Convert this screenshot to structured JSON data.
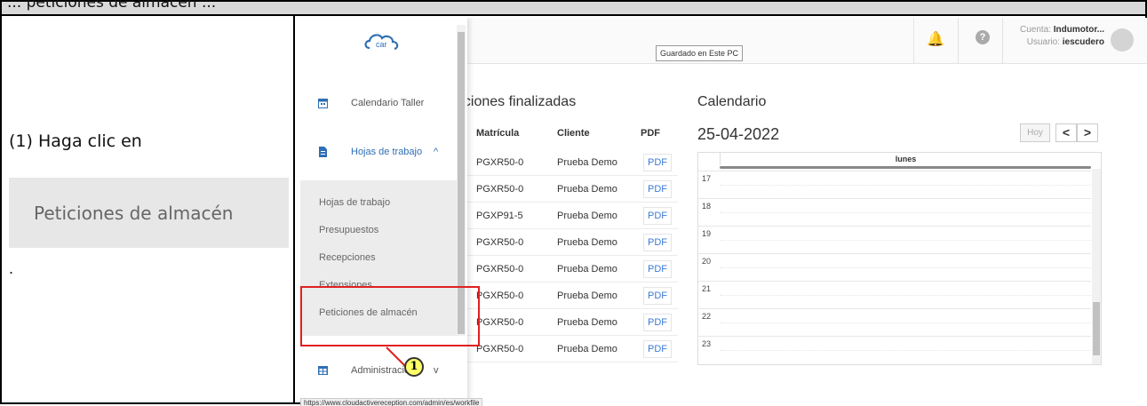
{
  "header": {
    "text": "... peticiones de almacén ..."
  },
  "instruction": {
    "step_text": "(1) Haga clic en",
    "button_image_label": "Peticiones de almacén",
    "trailing": "."
  },
  "app": {
    "saved_badge": "Guardado en Este PC",
    "account_label": "Cuenta:",
    "account_name": "Indumotor...",
    "user_label": "Usuario:",
    "user_name": "iescudero",
    "icons": [
      "bell-icon",
      "help-icon",
      "avatar"
    ]
  },
  "sidebar": {
    "logo_text": "car",
    "items": [
      {
        "label": "Calendario Taller",
        "icon": "calendar-icon"
      },
      {
        "label": "Hojas de trabajo",
        "icon": "document-icon",
        "expanded": true
      },
      {
        "label": "Administración",
        "icon": "table-icon"
      }
    ],
    "submenu": [
      "Hojas de trabajo",
      "Presupuestos",
      "Recepciones",
      "Extensiones",
      "Peticiones de almacén"
    ],
    "hojas_chevron": "^",
    "admin_chevron": "v"
  },
  "receptions": {
    "title": "pciones finalizadas",
    "columns": [
      "Matrícula",
      "Cliente",
      "PDF"
    ],
    "rows": [
      {
        "plate": "PGXR50-0",
        "client": "Prueba Demo",
        "pdf": "PDF"
      },
      {
        "plate": "PGXR50-0",
        "client": "Prueba Demo",
        "pdf": "PDF"
      },
      {
        "plate": "PGXP91-5",
        "client": "Prueba Demo",
        "pdf": "PDF"
      },
      {
        "plate": "PGXR50-0",
        "client": "Prueba Demo",
        "pdf": "PDF"
      },
      {
        "plate": "PGXR50-0",
        "client": "Prueba Demo",
        "pdf": "PDF"
      },
      {
        "plate": "PGXR50-0",
        "client": "Prueba Demo",
        "pdf": "PDF"
      },
      {
        "plate": "PGXR50-0",
        "client": "Prueba Demo",
        "pdf": "PDF"
      },
      {
        "plate": "PGXR50-0",
        "client": "Prueba Demo",
        "pdf": "PDF"
      }
    ]
  },
  "calendar": {
    "title": "Calendario",
    "date": "25-04-2022",
    "today_button": "Hoy",
    "prev": "<",
    "next": ">",
    "day": "lunes",
    "hours": [
      "17",
      "18",
      "19",
      "20",
      "21",
      "22",
      "23"
    ]
  },
  "status_url": "https://www.cloudactivereception.com/admin/es/workfile",
  "callout_number": "1",
  "colors": {
    "highlight": "#e02020",
    "callout_fill": "#ffff66",
    "link_blue": "#2f6fb5"
  }
}
